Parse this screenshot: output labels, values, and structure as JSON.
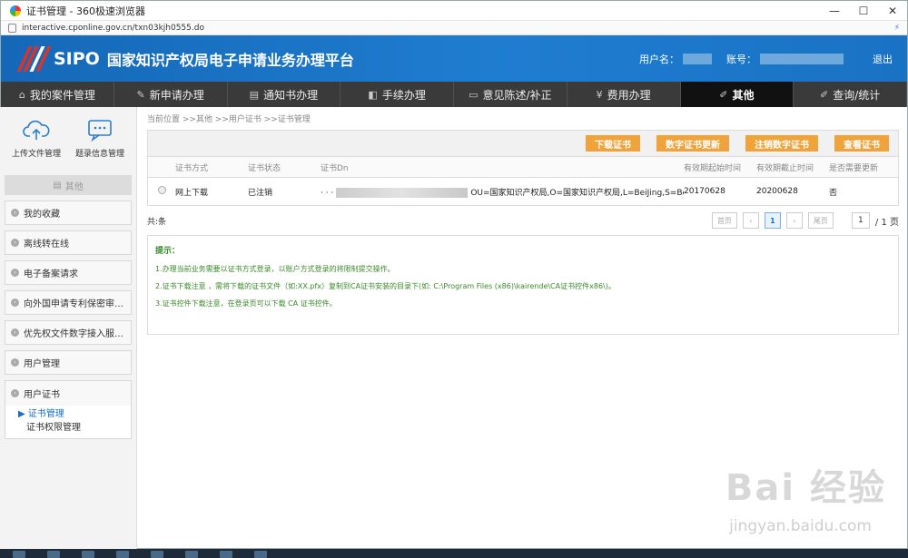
{
  "window": {
    "title": "证书管理 - 360极速浏览器",
    "min": "—",
    "max": "☐",
    "close": "✕"
  },
  "address": {
    "url": "interactive.cponline.gov.cn/txn03kjh0555.do"
  },
  "header": {
    "brand": "SIPO",
    "title": "国家知识产权局电子申请业务办理平台",
    "user_label": "用户名：",
    "account_label": "账号：",
    "logout": "退出"
  },
  "nav": [
    {
      "icon": "⌂",
      "label": "我的案件管理"
    },
    {
      "icon": "✎",
      "label": "新申请办理"
    },
    {
      "icon": "▤",
      "label": "通知书办理"
    },
    {
      "icon": "◧",
      "label": "手续办理"
    },
    {
      "icon": "▭",
      "label": "意见陈述/补正"
    },
    {
      "icon": "¥",
      "label": "费用办理"
    },
    {
      "icon": "✐",
      "label": "其他"
    },
    {
      "icon": "✐",
      "label": "查询/统计"
    }
  ],
  "sidebar": {
    "tools": [
      {
        "label": "上传文件管理"
      },
      {
        "label": "题录信息管理"
      }
    ],
    "section": "其他",
    "items": [
      "我的收藏",
      "离线转在线",
      "电子备案请求",
      "向外国申请专利保密审…",
      "优先权文件数字接入服…",
      "用户管理"
    ],
    "group": {
      "label": "用户证书",
      "subitems": [
        "证书管理",
        "证书权限管理"
      ]
    }
  },
  "breadcrumb": "当前位置 >>其他 >>用户证书 >>证书管理",
  "buttons": [
    "下载证书",
    "数字证书更新",
    "注销数字证书",
    "查看证书"
  ],
  "table": {
    "headers": [
      "证书方式",
      "证书状态",
      "证书Dn",
      "有效期起始时间",
      "有效期截止时间",
      "是否需要更新"
    ],
    "rows": [
      {
        "method": "网上下载",
        "status": "已注销",
        "dn_prefix": "· · ·",
        "dn": "OU=国家知识产权局,O=国家知识产权局,L=BeiJing,S=BeiJing,…",
        "start": "20170628",
        "end": "20200628",
        "update": "否"
      }
    ]
  },
  "pagination": {
    "total": "共:条",
    "first": "首页",
    "prev": "‹",
    "current": "1",
    "next": "›",
    "last": "尾页",
    "input": "1",
    "of": "/ 1 页"
  },
  "tips": {
    "title": "提示：",
    "lines": [
      "1.办理当前业务需要以证书方式登录，以账户方式登录的将限制提交操作。",
      "2.证书下载注意 ，需将下载的证书文件（如:XX.pfx）复制到CA证书安装的目录下(如: C:\\Program Files (x86)\\kairende\\CA证书控件x86\\)。",
      "3.证书控件下载注意，在登录页可以下载 CA 证书控件。"
    ]
  },
  "watermark": {
    "text": "Bai 经验",
    "url": "jingyan.baidu.com"
  }
}
